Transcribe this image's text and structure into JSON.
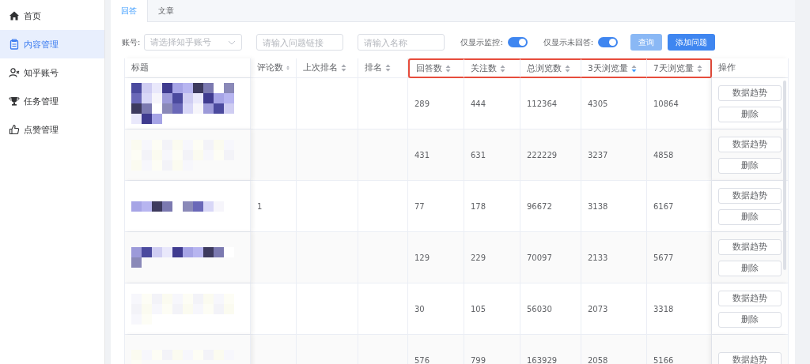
{
  "sidebar": {
    "items": [
      {
        "label": "首页",
        "kind": "home",
        "selected": false
      },
      {
        "label": "内容管理",
        "kind": "clipboard",
        "selected": true
      },
      {
        "label": "知乎账号",
        "kind": "user",
        "selected": false
      },
      {
        "label": "任务管理",
        "kind": "trophy",
        "selected": false
      },
      {
        "label": "点赞管理",
        "kind": "thumb",
        "selected": false
      }
    ]
  },
  "tabs": [
    {
      "label": "回答",
      "selected": true
    },
    {
      "label": "文章",
      "selected": false
    }
  ],
  "filters": {
    "account": {
      "label": "账号:",
      "placeholder": "请选择知乎账号"
    },
    "link": {
      "placeholder": "请输入问题链接"
    },
    "name": {
      "placeholder": "请输入名称"
    },
    "toggles": [
      {
        "label": "仅显示监控:",
        "on": true
      },
      {
        "label": "仅显示未回答:",
        "on": true
      }
    ],
    "buttons": [
      {
        "label": "查询",
        "disabled": true
      },
      {
        "label": "添加问题",
        "disabled": false
      }
    ]
  },
  "table": {
    "columns": [
      {
        "label": "标题",
        "sortable": false,
        "sorted_desc": false,
        "highlighted": false
      },
      {
        "label": "评论数",
        "sortable": true,
        "sorted_desc": false,
        "highlighted": false
      },
      {
        "label": "上次排名",
        "sortable": true,
        "sorted_desc": false,
        "highlighted": false
      },
      {
        "label": "排名",
        "sortable": true,
        "sorted_desc": false,
        "highlighted": false
      },
      {
        "label": "回答数",
        "sortable": true,
        "sorted_desc": false,
        "highlighted": true
      },
      {
        "label": "关注数",
        "sortable": true,
        "sorted_desc": false,
        "highlighted": true
      },
      {
        "label": "总浏览数",
        "sortable": true,
        "sorted_desc": false,
        "highlighted": true
      },
      {
        "label": "3天浏览量",
        "sortable": true,
        "sorted_desc": true,
        "highlighted": true
      },
      {
        "label": "7天浏览量",
        "sortable": true,
        "sorted_desc": false,
        "highlighted": true
      },
      {
        "label": "操作",
        "sortable": false,
        "sorted_desc": false,
        "highlighted": false
      }
    ],
    "rows": [
      {
        "title_redacted": true,
        "cells": [
          "",
          "",
          "",
          "",
          "289",
          "444",
          "112364",
          "4305",
          "10864"
        ],
        "actions": [
          "数据趋势",
          "删除"
        ]
      },
      {
        "title_redacted": true,
        "cells": [
          "",
          "",
          "",
          "",
          "431",
          "631",
          "222229",
          "3237",
          "4858"
        ],
        "actions": [
          "数据趋势",
          "删除"
        ]
      },
      {
        "title_redacted": true,
        "cells": [
          "",
          "1",
          "",
          "",
          "77",
          "178",
          "96672",
          "3138",
          "6167"
        ],
        "actions": [
          "数据趋势",
          "删除"
        ]
      },
      {
        "title_redacted": true,
        "cells": [
          "",
          "",
          "",
          "",
          "129",
          "229",
          "70097",
          "2133",
          "5677"
        ],
        "actions": [
          "数据趋势",
          "删除"
        ]
      },
      {
        "title_redacted": true,
        "cells": [
          "",
          "",
          "",
          "",
          "30",
          "105",
          "56030",
          "2073",
          "3318"
        ],
        "actions": [
          "数据趋势",
          "删除"
        ]
      },
      {
        "title_redacted": true,
        "cells": [
          "",
          "",
          "",
          "",
          "576",
          "799",
          "163929",
          "2058",
          "5166"
        ],
        "actions": [
          "数据趋势"
        ]
      }
    ]
  }
}
